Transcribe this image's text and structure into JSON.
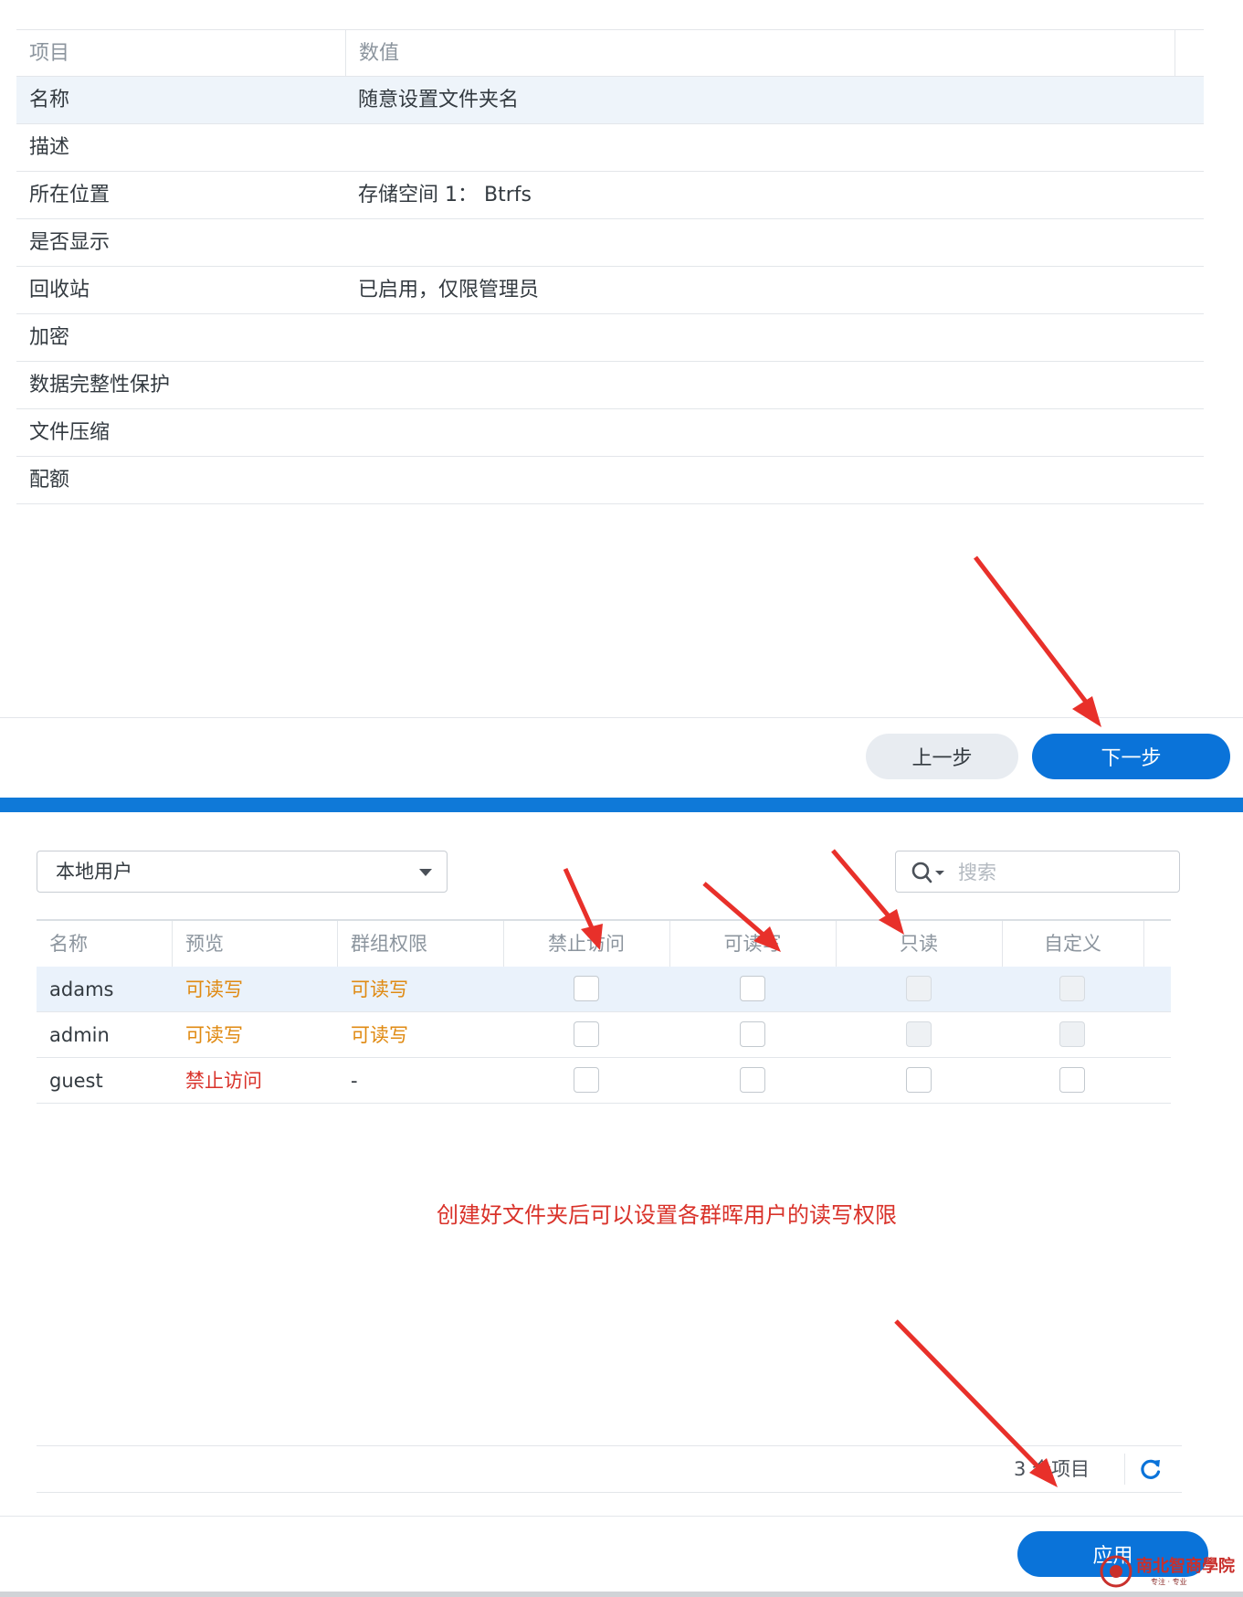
{
  "summary": {
    "headers": [
      "项目",
      "数值"
    ],
    "rows": [
      {
        "item": "名称",
        "value": "随意设置文件夹名"
      },
      {
        "item": "描述",
        "value": ""
      },
      {
        "item": "所在位置",
        "value": "存储空间 1： Btrfs"
      },
      {
        "item": "是否显示",
        "value": ""
      },
      {
        "item": "回收站",
        "value": "已启用，仅限管理员"
      },
      {
        "item": "加密",
        "value": ""
      },
      {
        "item": "数据完整性保护",
        "value": ""
      },
      {
        "item": "文件压缩",
        "value": ""
      },
      {
        "item": "配额",
        "value": ""
      }
    ]
  },
  "wizard": {
    "prev_label": "上一步",
    "next_label": "下一步"
  },
  "permissions": {
    "user_type": "本地用户",
    "search_placeholder": "搜索",
    "headers": [
      "名称",
      "预览",
      "群组权限",
      "禁止访问",
      "可读写",
      "只读",
      "自定义"
    ],
    "rows": [
      {
        "name": "adams",
        "preview": "可读写",
        "group": "可读写"
      },
      {
        "name": "admin",
        "preview": "可读写",
        "group": "可读写"
      },
      {
        "name": "guest",
        "preview": "禁止访问",
        "group": "-"
      }
    ],
    "annotation": "创建好文件夹后可以设置各群晖用户的读写权限",
    "count_text": "3 个项目",
    "apply_label": "应用"
  },
  "colors": {
    "accent": "#0a73d9",
    "orange": "#e08a12",
    "red": "#d9322a",
    "arrow": "#e8302a"
  },
  "watermark": {
    "text": "南北智商學院",
    "sub": "专注 · 专业"
  }
}
